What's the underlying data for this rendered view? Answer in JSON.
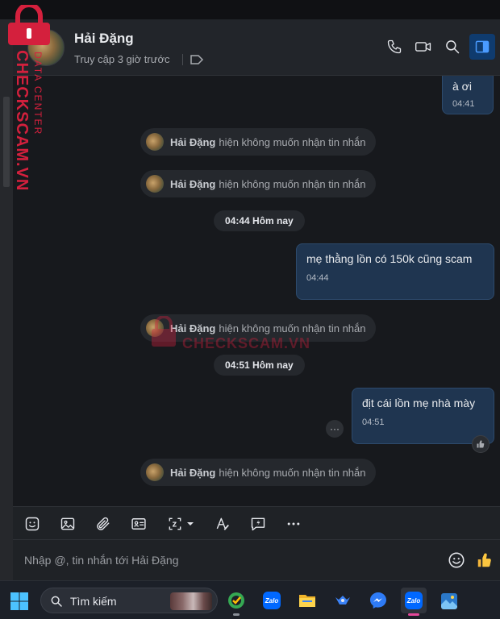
{
  "header": {
    "contact_name": "Hải Đặng",
    "status": "Truy cập 3 giờ trước"
  },
  "messages": [
    {
      "type": "outgoing",
      "text": "à ơi",
      "time": "04:41"
    },
    {
      "type": "system",
      "name": "Hải Đặng",
      "text": "hiện không muốn nhận tin nhắn"
    },
    {
      "type": "system",
      "name": "Hải Đặng",
      "text": "hiện không muốn nhận tin nhắn"
    },
    {
      "type": "time",
      "text": "04:44 Hôm nay"
    },
    {
      "type": "outgoing",
      "text": "mẹ thằng lồn có 150k cũng scam",
      "time": "04:44"
    },
    {
      "type": "system",
      "name": "Hải Đặng",
      "text": "hiện không muốn nhận tin nhắn"
    },
    {
      "type": "time",
      "text": "04:51 Hôm nay"
    },
    {
      "type": "outgoing",
      "text": "địt cái lồn mẹ nhà mày",
      "time": "04:51"
    },
    {
      "type": "system",
      "name": "Hải Đặng",
      "text": "hiện không muốn nhận tin nhắn"
    }
  ],
  "composer": {
    "placeholder": "Nhập @, tin nhắn tới Hải Đặng"
  },
  "taskbar": {
    "search_label": "Tìm kiếm"
  },
  "watermark": {
    "brand": "CHECKSCAM.VN",
    "subtitle": "DATA CENTER"
  },
  "colors": {
    "outgoing_bubble": "#1f3550",
    "accent": "#0068ff",
    "watermark": "#d4203d"
  }
}
